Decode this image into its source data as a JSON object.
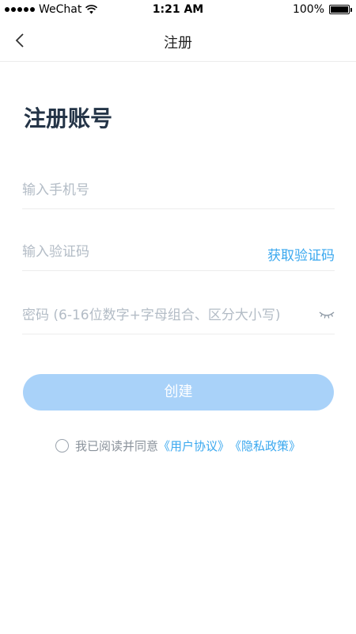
{
  "status_bar": {
    "carrier": "WeChat",
    "time": "1:21 AM",
    "battery": "100%"
  },
  "nav": {
    "title": "注册"
  },
  "page": {
    "title": "注册账号"
  },
  "form": {
    "phone_placeholder": "输入手机号",
    "code_placeholder": "输入验证码",
    "get_code_label": "获取验证码",
    "password_placeholder": "密码 (6-16位数字+字母组合、区分大小写)",
    "submit_label": "创建"
  },
  "agreement": {
    "text": "我已阅读并同意",
    "user_agreement": "《用户协议》",
    "privacy_policy": "《隐私政策》"
  },
  "colors": {
    "accent": "#3aa8ef",
    "button_disabled": "#a9d2f9",
    "title": "#243447",
    "placeholder": "#b3bcc6"
  }
}
